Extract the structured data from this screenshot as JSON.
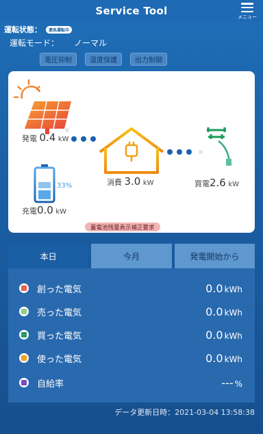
{
  "header": {
    "title": "Service Tool",
    "menu_label": "メニュー"
  },
  "status": {
    "label": "運転状態：",
    "badge": "連系運転中"
  },
  "mode": {
    "label": "運転モード：",
    "value": "ノーマル"
  },
  "controls": [
    "電圧抑制",
    "温度保護",
    "出力制御"
  ],
  "diagram": {
    "generation": {
      "label": "発電",
      "value": "0.4",
      "unit": "kW"
    },
    "battery": {
      "label": "充電",
      "value": "0.0",
      "unit": "kW",
      "percent": "33%",
      "level": 0.33
    },
    "consumption": {
      "label": "消費",
      "value": "3.0",
      "unit": "kW"
    },
    "purchase": {
      "label": "買電",
      "value": "2.6",
      "unit": "kW"
    },
    "warning": "蓄電池残量表示補正要求"
  },
  "tabs": [
    "本日",
    "今月",
    "発電開始から"
  ],
  "active_tab": 0,
  "rows": [
    {
      "label": "創った電気",
      "value": "0.0",
      "unit": "kWh",
      "color": "#e8604a"
    },
    {
      "label": "売った電気",
      "value": "0.0",
      "unit": "kWh",
      "color": "#8ed08a"
    },
    {
      "label": "買った電気",
      "value": "0.0",
      "unit": "kWh",
      "color": "#2a9a6a"
    },
    {
      "label": "使った電気",
      "value": "0.0",
      "unit": "kWh",
      "color": "#f2a020"
    },
    {
      "label": "自給率",
      "value": "---",
      "unit": "%",
      "color": "#7a4ec0"
    }
  ],
  "footer": {
    "updated_label": "データ更新日時：",
    "updated_value": "2021-03-04 13:58:38"
  }
}
